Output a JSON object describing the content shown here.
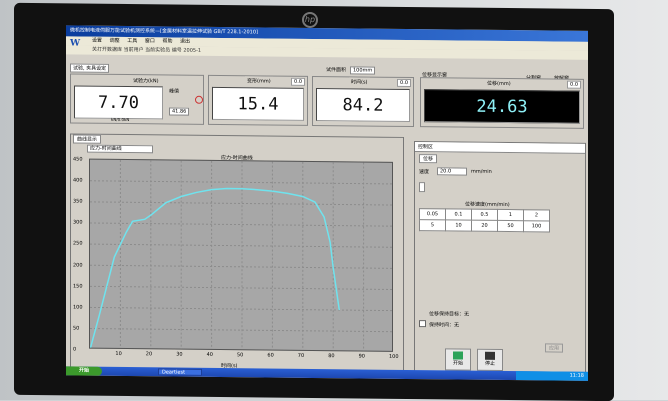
{
  "window": {
    "title": "微机控制电液伺服万能试验机测控系统—[金属材料室温拉伸试验 GB/T 228.1-2010]"
  },
  "menu": [
    "设置",
    "调整",
    "工具",
    "窗口",
    "帮助",
    "退出"
  ],
  "subbar": "关打开数据库 当前用户 当前实验员 编号 2005-1",
  "toolbar": {
    "specimen_tab": "试验, 夹具设定",
    "specimen_area_label": "试件面积",
    "specimen_area_value": "100mm",
    "split_window": "分割窗",
    "release_window": "放解窗"
  },
  "displays": {
    "force": {
      "label": "试验力(kN)",
      "value": "7.70",
      "peak_label": "峰值",
      "peak_value": "41.86",
      "sub": "kN/0.0kN",
      "small": "0.0"
    },
    "deform": {
      "label": "变形(mm)",
      "value": "15.4",
      "small": "0.0"
    },
    "time": {
      "label": "时间(s)",
      "value": "84.2",
      "small": "0.0"
    },
    "displacement": {
      "label": "位移(mm)",
      "value": "24.63",
      "small": "0.0",
      "header": "位移显示窗"
    }
  },
  "chart": {
    "window_tab": "曲线显示",
    "select": "应力-时间曲线",
    "title": "应力-时间曲线",
    "y_ticks": [
      "450",
      "400",
      "350",
      "300",
      "250",
      "200",
      "150",
      "100",
      "50",
      "0"
    ],
    "x_ticks": [
      "10",
      "20",
      "30",
      "40",
      "50",
      "60",
      "70",
      "80",
      "90",
      "100"
    ],
    "xlabel": "时间(s)"
  },
  "chart_data": {
    "type": "line",
    "title": "应力-时间曲线",
    "xlabel": "时间(s)",
    "ylabel": "",
    "xlim": [
      0,
      100
    ],
    "ylim": [
      0,
      450
    ],
    "series": [
      {
        "x": [
          0,
          3,
          8,
          12,
          14,
          18,
          20,
          25,
          30,
          35,
          40,
          45,
          50,
          55,
          60,
          65,
          70,
          74,
          77,
          79,
          80,
          81,
          82
        ],
        "y": [
          0,
          80,
          220,
          280,
          305,
          310,
          320,
          350,
          365,
          375,
          382,
          385,
          385,
          383,
          380,
          375,
          368,
          355,
          320,
          260,
          200,
          150,
          100
        ]
      }
    ]
  },
  "control": {
    "header": "控制区",
    "mode": "位移",
    "speed_label": "速度",
    "speed_value": "20.0",
    "speed_unit": "mm/min",
    "grid_title": "位移速度(mm/min)",
    "grid": [
      [
        "0.05",
        "0.1",
        "0.5",
        "1",
        "2"
      ],
      [
        "5",
        "10",
        "20",
        "50",
        "100"
      ]
    ],
    "limit_label": "位移保持目标：无",
    "hold_label": "保持时间：无",
    "apply": "应用",
    "start": "开始",
    "stop": "停止"
  },
  "taskbar": {
    "start": "开始",
    "task": "Deartiest",
    "clock": "11:18"
  }
}
